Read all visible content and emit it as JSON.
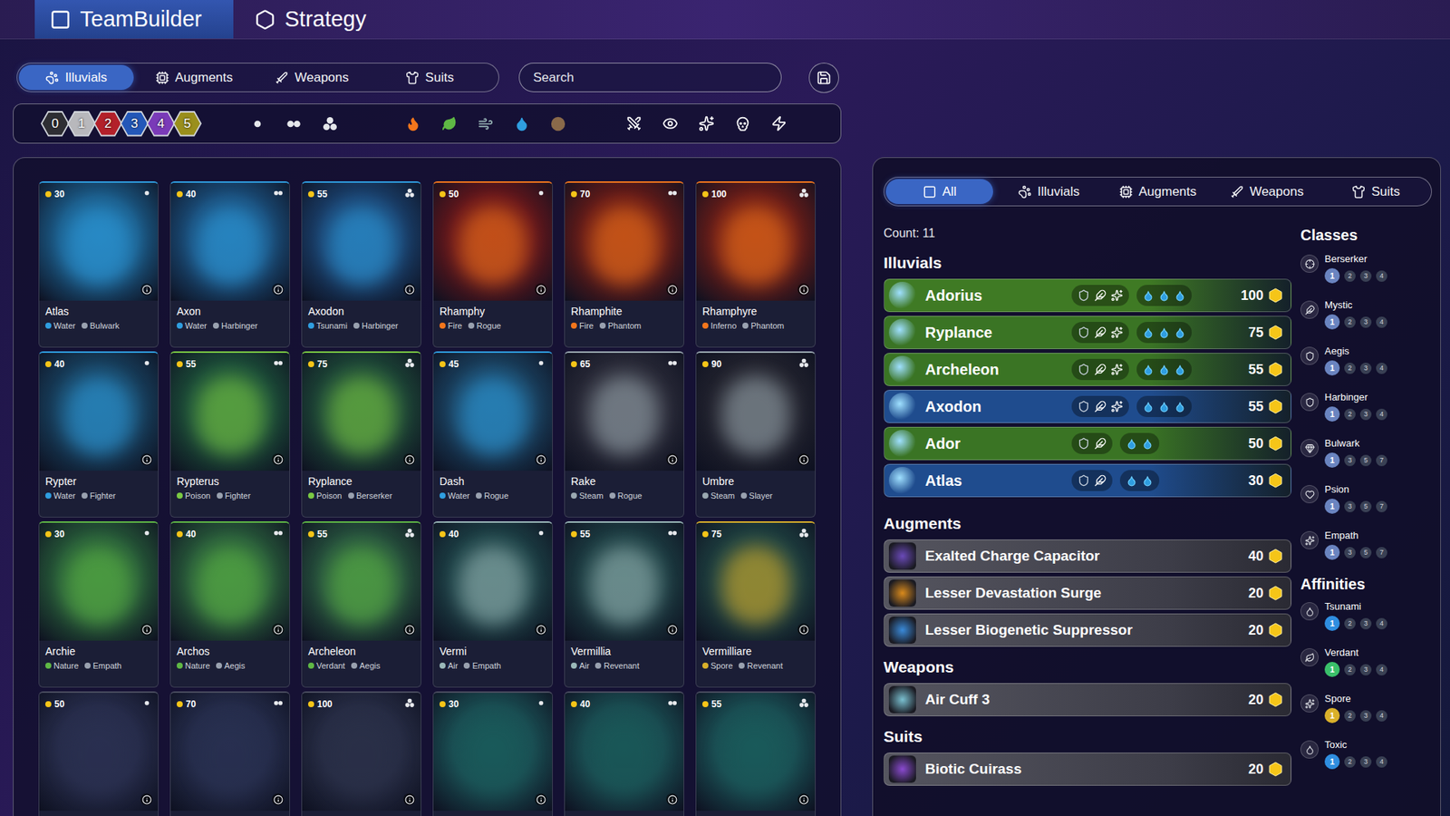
{
  "header_tabs": [
    {
      "label": "TeamBuilder",
      "selected": true,
      "kind": "teambuilder"
    },
    {
      "label": "Strategy",
      "selected": false,
      "kind": "strategy"
    }
  ],
  "category_tabs": [
    {
      "label": "Illuvials",
      "selected": true,
      "kind": "illuvials"
    },
    {
      "label": "Augments",
      "selected": false,
      "kind": "augments"
    },
    {
      "label": "Weapons",
      "selected": false,
      "kind": "weapons"
    },
    {
      "label": "Suits",
      "selected": false,
      "kind": "suits"
    }
  ],
  "search": {
    "placeholder": "Search"
  },
  "tier_filters": [
    {
      "label": "0",
      "color": "#2e2e33"
    },
    {
      "label": "1",
      "color": "#b8b8bc"
    },
    {
      "label": "2",
      "color": "#b3202a"
    },
    {
      "label": "3",
      "color": "#2357b8"
    },
    {
      "label": "4",
      "color": "#7a3ab8"
    },
    {
      "label": "5",
      "color": "#9a8f1c"
    }
  ],
  "stage_filters": [
    1,
    2,
    3
  ],
  "affinity_filters": [
    {
      "kind": "fire",
      "color": "#f2761c"
    },
    {
      "kind": "nature",
      "color": "#5fb845"
    },
    {
      "kind": "air",
      "color": "#9ab8b8"
    },
    {
      "kind": "water",
      "color": "#2f9ee0"
    },
    {
      "kind": "earth",
      "color": "#8a6a4a"
    }
  ],
  "class_filters": [
    {
      "kind": "fighter"
    },
    {
      "kind": "psion"
    },
    {
      "kind": "empath"
    },
    {
      "kind": "slayer"
    },
    {
      "kind": "rogue"
    }
  ],
  "cards": [
    {
      "name": "Atlas",
      "cost": "30",
      "stage": 1,
      "affinity": "Water",
      "class": "Bulwark",
      "color": "#1b6a9c",
      "affinity_color": "#2f9ee0"
    },
    {
      "name": "Axon",
      "cost": "40",
      "stage": 2,
      "affinity": "Water",
      "class": "Harbinger",
      "color": "#1a5a8c",
      "affinity_color": "#2f9ee0"
    },
    {
      "name": "Axodon",
      "cost": "55",
      "stage": 3,
      "affinity": "Tsunami",
      "class": "Harbinger",
      "color": "#1a4a7c",
      "affinity_color": "#2f9ee0"
    },
    {
      "name": "Rhamphy",
      "cost": "50",
      "stage": 1,
      "affinity": "Fire",
      "class": "Rogue",
      "color": "#7a1414",
      "affinity_color": "#f2761c"
    },
    {
      "name": "Rhamphite",
      "cost": "70",
      "stage": 2,
      "affinity": "Fire",
      "class": "Phantom",
      "color": "#7a1a10",
      "affinity_color": "#f2761c"
    },
    {
      "name": "Rhamphyre",
      "cost": "100",
      "stage": 3,
      "affinity": "Inferno",
      "class": "Phantom",
      "color": "#801c10",
      "affinity_color": "#f2761c"
    },
    {
      "name": "Rypter",
      "cost": "40",
      "stage": 1,
      "affinity": "Water",
      "class": "Fighter",
      "color": "#174a6a",
      "affinity_color": "#2f9ee0"
    },
    {
      "name": "Rypterus",
      "cost": "55",
      "stage": 2,
      "affinity": "Poison",
      "class": "Fighter",
      "color": "#1c5a3a",
      "affinity_color": "#7ac943"
    },
    {
      "name": "Ryplance",
      "cost": "75",
      "stage": 3,
      "affinity": "Poison",
      "class": "Berserker",
      "color": "#1e5238",
      "affinity_color": "#7ac943"
    },
    {
      "name": "Dash",
      "cost": "45",
      "stage": 1,
      "affinity": "Water",
      "class": "Rogue",
      "color": "#1a4a6a",
      "affinity_color": "#2f9ee0"
    },
    {
      "name": "Rake",
      "cost": "65",
      "stage": 2,
      "affinity": "Steam",
      "class": "Rogue",
      "color": "#2d2d38",
      "affinity_color": "#9aa8b0"
    },
    {
      "name": "Umbre",
      "cost": "90",
      "stage": 3,
      "affinity": "Steam",
      "class": "Slayer",
      "color": "#24242c",
      "affinity_color": "#9aa8b0"
    },
    {
      "name": "Archie",
      "cost": "30",
      "stage": 1,
      "affinity": "Nature",
      "class": "Empath",
      "color": "#2a6a3a",
      "affinity_color": "#5fb845"
    },
    {
      "name": "Archos",
      "cost": "40",
      "stage": 2,
      "affinity": "Nature",
      "class": "Aegis",
      "color": "#2c6a3c",
      "affinity_color": "#5fb845"
    },
    {
      "name": "Archeleon",
      "cost": "55",
      "stage": 3,
      "affinity": "Verdant",
      "class": "Aegis",
      "color": "#2a6040",
      "affinity_color": "#5fb845"
    },
    {
      "name": "Vermi",
      "cost": "40",
      "stage": 1,
      "affinity": "Air",
      "class": "Empath",
      "color": "#1d4a4a",
      "affinity_color": "#9ab8b8"
    },
    {
      "name": "Vermillia",
      "cost": "55",
      "stage": 2,
      "affinity": "Air",
      "class": "Revenant",
      "color": "#1d4646",
      "affinity_color": "#9ab8b8"
    },
    {
      "name": "Vermilliare",
      "cost": "75",
      "stage": 3,
      "affinity": "Spore",
      "class": "Revenant",
      "color": "#1f4a44",
      "affinity_color": "#d9b02a"
    },
    {
      "cost": "50",
      "stage": 1,
      "color": "#2a3050"
    },
    {
      "cost": "70",
      "stage": 2,
      "color": "#283050"
    },
    {
      "cost": "100",
      "stage": 3,
      "color": "#2a3048"
    },
    {
      "cost": "30",
      "stage": 1,
      "color": "#1a5a5a"
    },
    {
      "cost": "40",
      "stage": 2,
      "color": "#1a5858"
    },
    {
      "cost": "55",
      "stage": 3,
      "color": "#1a5a5a"
    }
  ],
  "team": {
    "tabs": [
      {
        "label": "All",
        "selected": true,
        "kind": "all"
      },
      {
        "label": "Illuvials",
        "selected": false,
        "kind": "illuvials"
      },
      {
        "label": "Augments",
        "selected": false,
        "kind": "augments"
      },
      {
        "label": "Weapons",
        "selected": false,
        "kind": "weapons"
      },
      {
        "label": "Suits",
        "selected": false,
        "kind": "suits"
      }
    ],
    "count": "Count: 11",
    "illuvials_title": "Illuvials",
    "illuvials": [
      {
        "name": "Adorius",
        "cost": "100",
        "color": "#3f7a24",
        "class_icons": 3,
        "affinity_icons": 3
      },
      {
        "name": "Ryplance",
        "cost": "75",
        "color": "#3a7424",
        "class_icons": 3,
        "affinity_icons": 3
      },
      {
        "name": "Archeleon",
        "cost": "55",
        "color": "#3a7424",
        "class_icons": 3,
        "affinity_icons": 3
      },
      {
        "name": "Axodon",
        "cost": "55",
        "color": "#1f4c8e",
        "class_icons": 3,
        "affinity_icons": 3
      },
      {
        "name": "Ador",
        "cost": "50",
        "color": "#3a7424",
        "class_icons": 2,
        "affinity_icons": 2
      },
      {
        "name": "Atlas",
        "cost": "30",
        "color": "#1f4c8e",
        "class_icons": 2,
        "affinity_icons": 2
      }
    ],
    "augments_title": "Augments",
    "augments": [
      {
        "name": "Exalted Charge Capacitor",
        "cost": "40",
        "color": "#6a4ab8"
      },
      {
        "name": "Lesser Devastation Surge",
        "cost": "20",
        "color": "#d98a1c"
      },
      {
        "name": "Lesser Biogenetic Suppressor",
        "cost": "20",
        "color": "#3a8ad9"
      }
    ],
    "weapons_title": "Weapons",
    "weapons": [
      {
        "name": "Air Cuff 3",
        "cost": "20",
        "color": "#7ac0d0"
      }
    ],
    "suits_title": "Suits",
    "suits": [
      {
        "name": "Biotic Cuirass",
        "cost": "20",
        "color": "#8a4ad0"
      }
    ]
  },
  "classes_title": "Classes",
  "classes": [
    {
      "name": "Berserker",
      "color": "#6a84c0",
      "thresholds": [
        {
          "label": "1",
          "active": true
        },
        {
          "label": "2",
          "active": false
        },
        {
          "label": "3",
          "active": false
        },
        {
          "label": "4",
          "active": false
        }
      ]
    },
    {
      "name": "Mystic",
      "color": "#6a84c0",
      "thresholds": [
        {
          "label": "1",
          "active": true
        },
        {
          "label": "2",
          "active": false
        },
        {
          "label": "3",
          "active": false
        },
        {
          "label": "4",
          "active": false
        }
      ]
    },
    {
      "name": "Aegis",
      "color": "#6a84c0",
      "thresholds": [
        {
          "label": "1",
          "active": true
        },
        {
          "label": "2",
          "active": false
        },
        {
          "label": "3",
          "active": false
        },
        {
          "label": "4",
          "active": false
        }
      ]
    },
    {
      "name": "Harbinger",
      "color": "#6a84c0",
      "thresholds": [
        {
          "label": "1",
          "active": true
        },
        {
          "label": "2",
          "active": false
        },
        {
          "label": "3",
          "active": false
        },
        {
          "label": "4",
          "active": false
        }
      ]
    },
    {
      "name": "Bulwark",
      "color": "#6a84c0",
      "thresholds": [
        {
          "label": "1",
          "active": true
        },
        {
          "label": "3",
          "active": false
        },
        {
          "label": "5",
          "active": false
        },
        {
          "label": "7",
          "active": false
        }
      ]
    },
    {
      "name": "Psion",
      "color": "#6a84c0",
      "thresholds": [
        {
          "label": "1",
          "active": true
        },
        {
          "label": "3",
          "active": false
        },
        {
          "label": "5",
          "active": false
        },
        {
          "label": "7",
          "active": false
        }
      ]
    },
    {
      "name": "Empath",
      "color": "#6a84c0",
      "thresholds": [
        {
          "label": "1",
          "active": true
        },
        {
          "label": "3",
          "active": false
        },
        {
          "label": "5",
          "active": false
        },
        {
          "label": "7",
          "active": false
        }
      ]
    }
  ],
  "affinities_title": "Affinities",
  "affinities": [
    {
      "name": "Tsunami",
      "color": "#2f8ee0",
      "thresholds": [
        {
          "label": "1",
          "active": true
        },
        {
          "label": "2",
          "active": false
        },
        {
          "label": "3",
          "active": false
        },
        {
          "label": "4",
          "active": false
        }
      ]
    },
    {
      "name": "Verdant",
      "color": "#3ac06a",
      "thresholds": [
        {
          "label": "1",
          "active": true
        },
        {
          "label": "2",
          "active": false
        },
        {
          "label": "3",
          "active": false
        },
        {
          "label": "4",
          "active": false
        }
      ]
    },
    {
      "name": "Spore",
      "color": "#d9b02a",
      "thresholds": [
        {
          "label": "1",
          "active": true
        },
        {
          "label": "2",
          "active": false
        },
        {
          "label": "3",
          "active": false
        },
        {
          "label": "4",
          "active": false
        }
      ]
    },
    {
      "name": "Toxic",
      "color": "#2f8ee0",
      "thresholds": [
        {
          "label": "1",
          "active": true
        },
        {
          "label": "2",
          "active": false
        },
        {
          "label": "3",
          "active": false
        },
        {
          "label": "4",
          "active": false
        }
      ]
    }
  ]
}
